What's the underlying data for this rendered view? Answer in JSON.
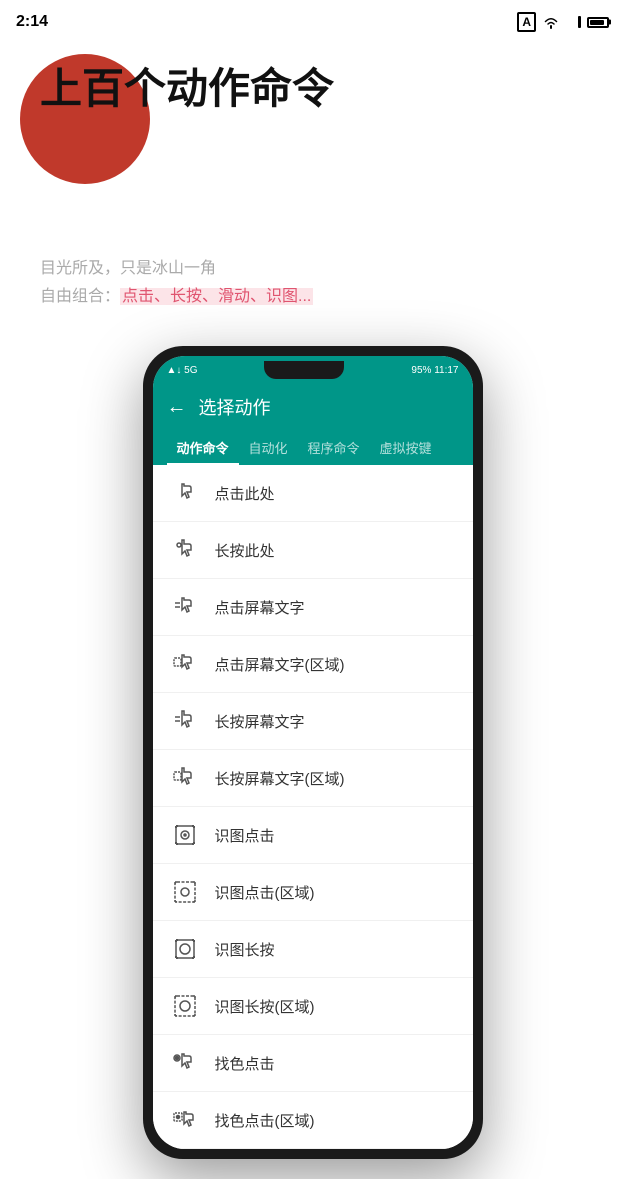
{
  "statusBar": {
    "time": "2:14",
    "simIcon": "A"
  },
  "hero": {
    "title": "上百个动作命令",
    "subtitle1": "目光所及，只是冰山一角",
    "subtitle2_prefix": "自由组合：",
    "subtitle2_highlight": "点击、长按、滑动、识图...",
    "circleColor": "#c0392b"
  },
  "phone": {
    "statusLeft": "↑↓▲↓  5G",
    "statusRight": "95%  11:17",
    "toolbarTitle": "选择动作",
    "backArrow": "←",
    "tabs": [
      {
        "label": "动作命令",
        "active": true
      },
      {
        "label": "自动化",
        "active": false
      },
      {
        "label": "程序命令",
        "active": false
      },
      {
        "label": "虚拟按键",
        "active": false
      }
    ],
    "listItems": [
      {
        "label": "点击此处",
        "iconType": "tap"
      },
      {
        "label": "长按此处",
        "iconType": "longpress"
      },
      {
        "label": "点击屏幕文字",
        "iconType": "tap-text"
      },
      {
        "label": "点击屏幕文字(区域)",
        "iconType": "tap-text-region"
      },
      {
        "label": "长按屏幕文字",
        "iconType": "longpress-text"
      },
      {
        "label": "长按屏幕文字(区域)",
        "iconType": "longpress-text-region"
      },
      {
        "label": "识图点击",
        "iconType": "image-click"
      },
      {
        "label": "识图点击(区域)",
        "iconType": "image-click-region"
      },
      {
        "label": "识图长按",
        "iconType": "image-longpress"
      },
      {
        "label": "识图长按(区域)",
        "iconType": "image-longpress-region"
      },
      {
        "label": "找色点击",
        "iconType": "color-click"
      },
      {
        "label": "找色点击(区域)",
        "iconType": "color-click-region"
      }
    ]
  }
}
